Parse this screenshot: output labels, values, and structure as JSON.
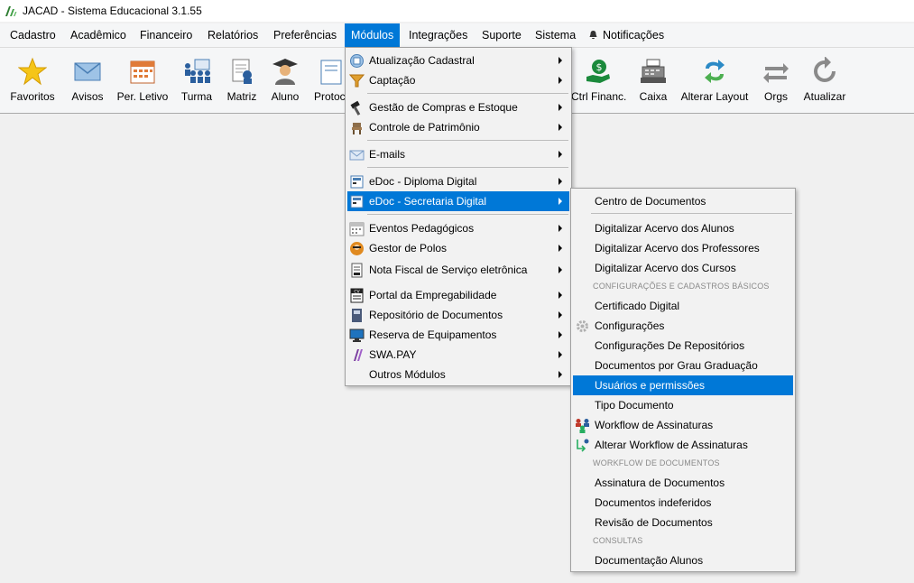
{
  "window": {
    "title": "JACAD - Sistema Educacional 3.1.55"
  },
  "menubar": {
    "items": [
      "Cadastro",
      "Acadêmico",
      "Financeiro",
      "Relatórios",
      "Preferências",
      "Módulos",
      "Integrações",
      "Suporte",
      "Sistema",
      "Notificações"
    ],
    "active": "Módulos"
  },
  "toolbar": {
    "buttons": [
      "Favoritos",
      "Avisos",
      "Per. Letivo",
      "Turma",
      "Matriz",
      "Aluno",
      "Protoc",
      "Ctrl Financ.",
      "Caixa",
      "Alterar Layout",
      "Orgs",
      "Atualizar"
    ]
  },
  "modulos_menu": {
    "items": [
      {
        "label": "Atualização Cadastral",
        "icon": "form-icon"
      },
      {
        "label": "Captação",
        "icon": "funnel-icon"
      },
      {
        "label": "Gestão de Compras e Estoque",
        "icon": "hammer-icon"
      },
      {
        "label": "Controle de Patrimônio",
        "icon": "chair-icon"
      },
      {
        "label": "E-mails",
        "icon": "envelope-icon"
      },
      {
        "label": "eDoc - Diploma Digital",
        "icon": "document-icon"
      },
      {
        "label": "eDoc - Secretaria Digital",
        "icon": "document-icon"
      },
      {
        "label": "Eventos Pedagógicos",
        "icon": "calendar-icon"
      },
      {
        "label": "Gestor de Polos",
        "icon": "pole-manager-icon"
      },
      {
        "label": "Nota Fiscal de Serviço eletrônica",
        "icon": "invoice-icon"
      },
      {
        "label": "Portal da Empregabilidade",
        "icon": "cv-icon"
      },
      {
        "label": "Repositório de Documentos",
        "icon": "book-icon"
      },
      {
        "label": "Reserva de Equipamentos",
        "icon": "monitor-icon"
      },
      {
        "label": "SWA.PAY",
        "icon": "swa-pay-icon"
      },
      {
        "label": "Outros Módulos",
        "icon": ""
      }
    ],
    "highlighted": "eDoc - Secretaria Digital"
  },
  "submenu": {
    "items": [
      {
        "label": "Centro de Documentos"
      },
      {
        "label": "Digitalizar Acervo dos Alunos"
      },
      {
        "label": "Digitalizar Acervo dos Professores"
      },
      {
        "label": "Digitalizar Acervo dos Cursos"
      },
      {
        "label": "Certificado Digital"
      },
      {
        "label": "Configurações",
        "icon": "gear-icon"
      },
      {
        "label": "Configurações De Repositórios"
      },
      {
        "label": "Documentos por Grau Graduação"
      },
      {
        "label": "Usuários e permissões"
      },
      {
        "label": "Tipo Documento"
      },
      {
        "label": "Workflow de Assinaturas",
        "icon": "people-icon"
      },
      {
        "label": "Alterar Workflow de Assinaturas",
        "icon": "refresh-flow-icon"
      },
      {
        "label": "Assinatura de Documentos"
      },
      {
        "label": "Documentos indeferidos"
      },
      {
        "label": "Revisão de Documentos"
      },
      {
        "label": "Documentação Alunos"
      }
    ],
    "headers": [
      "CONFIGURAÇÕES E CADASTROS BÁSICOS",
      "WORKFLOW DE DOCUMENTOS",
      "CONSULTAS"
    ],
    "highlighted": "Usuários e permissões"
  }
}
